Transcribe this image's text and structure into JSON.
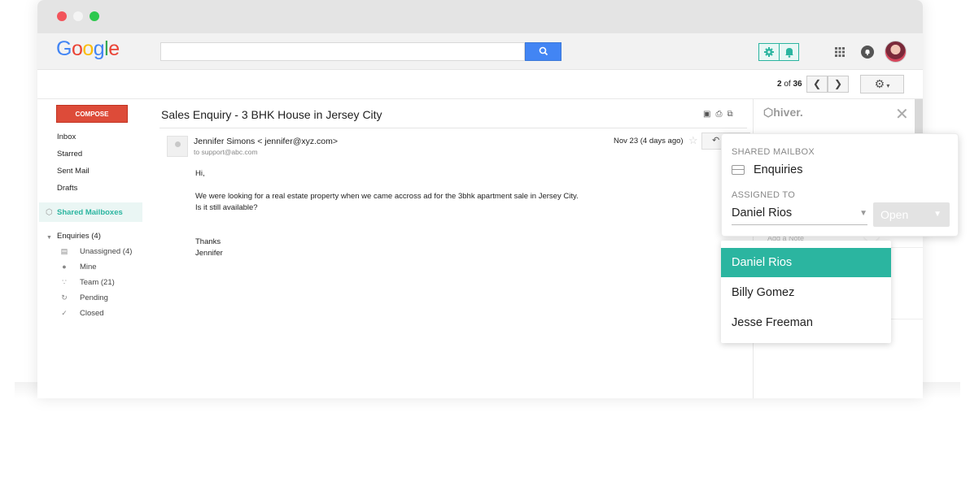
{
  "browser": {
    "logo": "Google",
    "logo_colors": [
      "#4285f4",
      "#ea4335",
      "#fbbc05",
      "#4285f4",
      "#34a853",
      "#ea4335"
    ],
    "search": {
      "placeholder": "",
      "value": ""
    }
  },
  "toolbar": {
    "pager_current": "2",
    "pager_separator": "of",
    "pager_total": "36",
    "prev_icon": "chevron-left-icon",
    "next_icon": "chevron-right-icon",
    "settings_icon": "gear-icon"
  },
  "sidebar": {
    "compose_label": "COMPOSE",
    "compose_color": "#dd4b39",
    "items": [
      {
        "label": "Inbox"
      },
      {
        "label": "Starred"
      },
      {
        "label": "Sent Mail"
      },
      {
        "label": "Drafts"
      }
    ],
    "shared_label": "Shared Mailboxes",
    "enquiries_label": "Enquiries (4)",
    "subitems": [
      {
        "label": "Unassigned (4)",
        "icon": "inbox-tray-icon"
      },
      {
        "label": "Mine",
        "icon": "person-icon"
      },
      {
        "label": "Team (21)",
        "icon": "team-icon"
      },
      {
        "label": "Pending",
        "icon": "refresh-icon"
      },
      {
        "label": "Closed",
        "icon": "check-circle-icon"
      }
    ]
  },
  "email": {
    "subject": "Sales Enquiry - 3 BHK House in Jersey City",
    "sender": "Jennifer Simons < jennifer@xyz.com>",
    "to": "to support@abc.com",
    "date": "Nov 23 (4 days ago)",
    "body": [
      "Hi,",
      "We were looking for a real estate property when we came accross ad for the 3bhk apartment sale in Jersey City.",
      "Is it still available?",
      "Thanks",
      "Jennifer"
    ]
  },
  "hiver": {
    "logo": "hiver.",
    "add_note": "Add a Note",
    "accent_color": "#2bb5a0"
  },
  "popup": {
    "shared_mailbox_label": "SHARED MAILBOX",
    "mailbox_name": "Enquiries",
    "assigned_to_label": "ASSIGNED TO",
    "assignee": "Daniel Rios",
    "status": "Open"
  },
  "dropdown": {
    "options": [
      "Daniel Rios",
      "Billy Gomez",
      "Jesse Freeman"
    ],
    "selected_index": 0
  }
}
